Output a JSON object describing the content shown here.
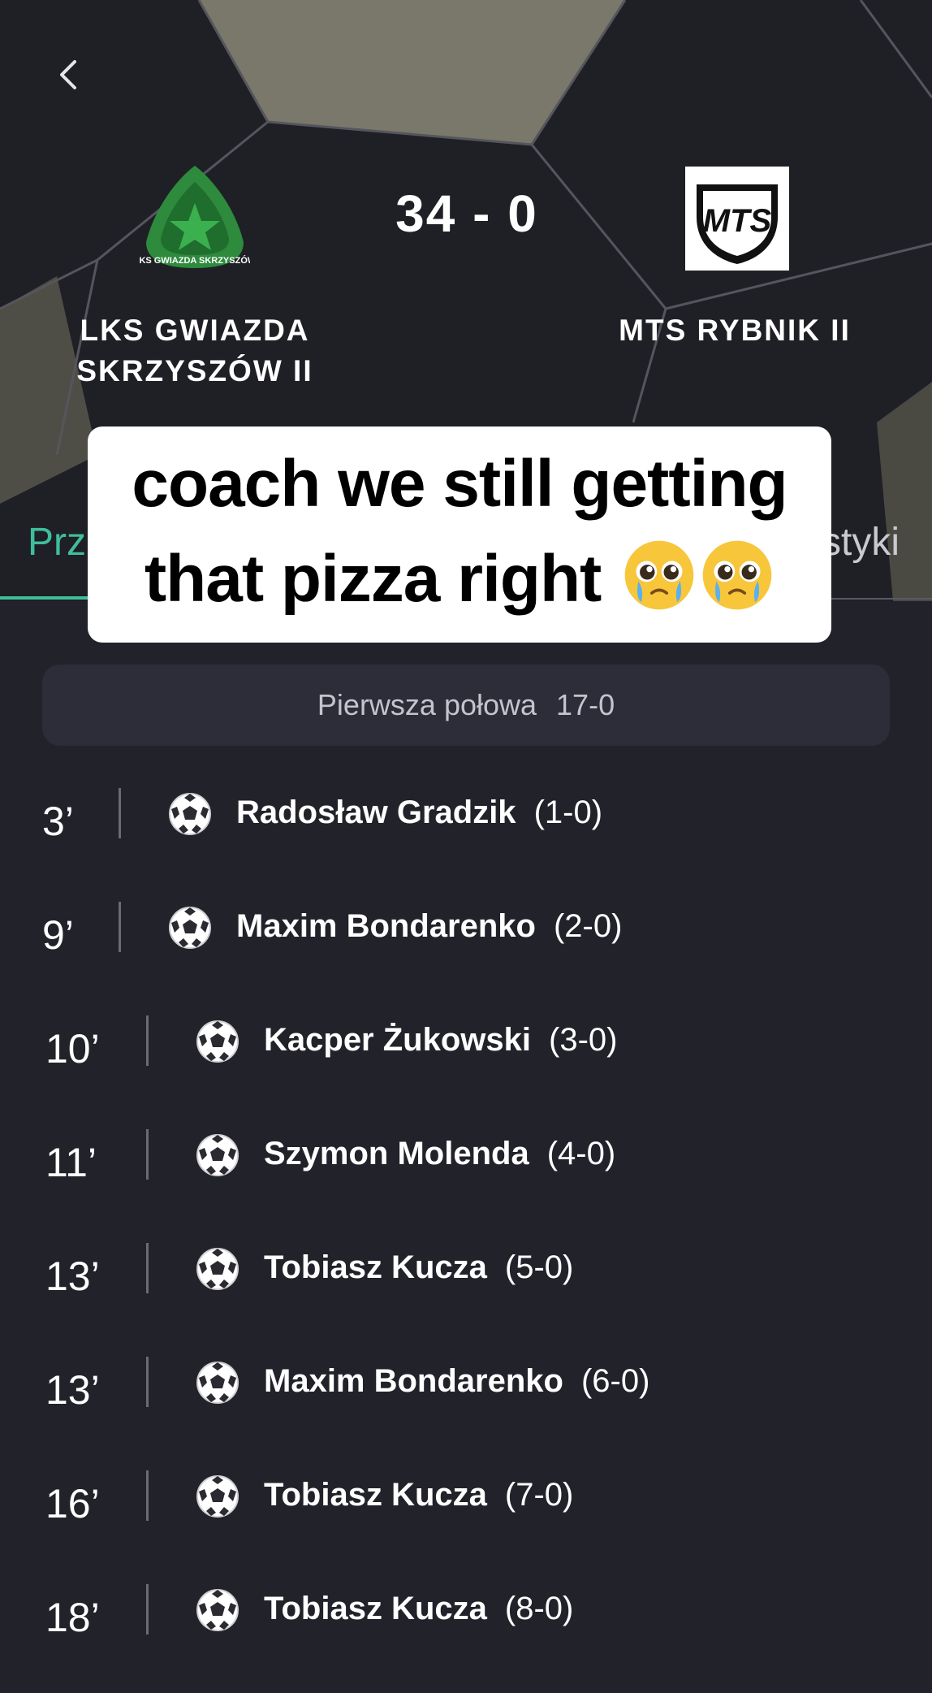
{
  "match": {
    "home_team": "LKS GWIAZDA SKRZYSZÓW II",
    "home_team_line1": "LKS GWIAZDA",
    "home_team_line2": "SKRZYSZÓW II",
    "away_team": "MTS RYBNIK II",
    "score": "34 - 0",
    "home_crest_text": "LKS GWIAZDA SKRZYSZÓW",
    "away_logo_text": "MTS"
  },
  "tabs": {
    "left_partial": "Prz",
    "right_partial": "styki"
  },
  "caption": {
    "line1": "coach we still getting",
    "line2": "that pizza right",
    "emoji": "pleading-face-with-tears"
  },
  "half_banner": {
    "label": "Pierwsza połowa",
    "score": "17-0"
  },
  "events": [
    {
      "minute": "3’",
      "player": "Radosław Gradzik",
      "score": "(1-0)"
    },
    {
      "minute": "9’",
      "player": "Maxim Bondarenko",
      "score": "(2-0)"
    },
    {
      "minute": "10’",
      "player": "Kacper Żukowski",
      "score": "(3-0)"
    },
    {
      "minute": "11’",
      "player": "Szymon Molenda",
      "score": "(4-0)"
    },
    {
      "minute": "13’",
      "player": "Tobiasz Kucza",
      "score": "(5-0)"
    },
    {
      "minute": "13’",
      "player": "Maxim Bondarenko",
      "score": "(6-0)"
    },
    {
      "minute": "16’",
      "player": "Tobiasz Kucza",
      "score": "(7-0)"
    },
    {
      "minute": "18’",
      "player": "Tobiasz Kucza",
      "score": "(8-0)"
    }
  ],
  "colors": {
    "accent": "#3fbf99",
    "background": "#22222a",
    "crest_green": "#2e8b3e"
  },
  "icons": {
    "back": "chevron-left-icon",
    "goal": "soccer-ball-icon"
  }
}
